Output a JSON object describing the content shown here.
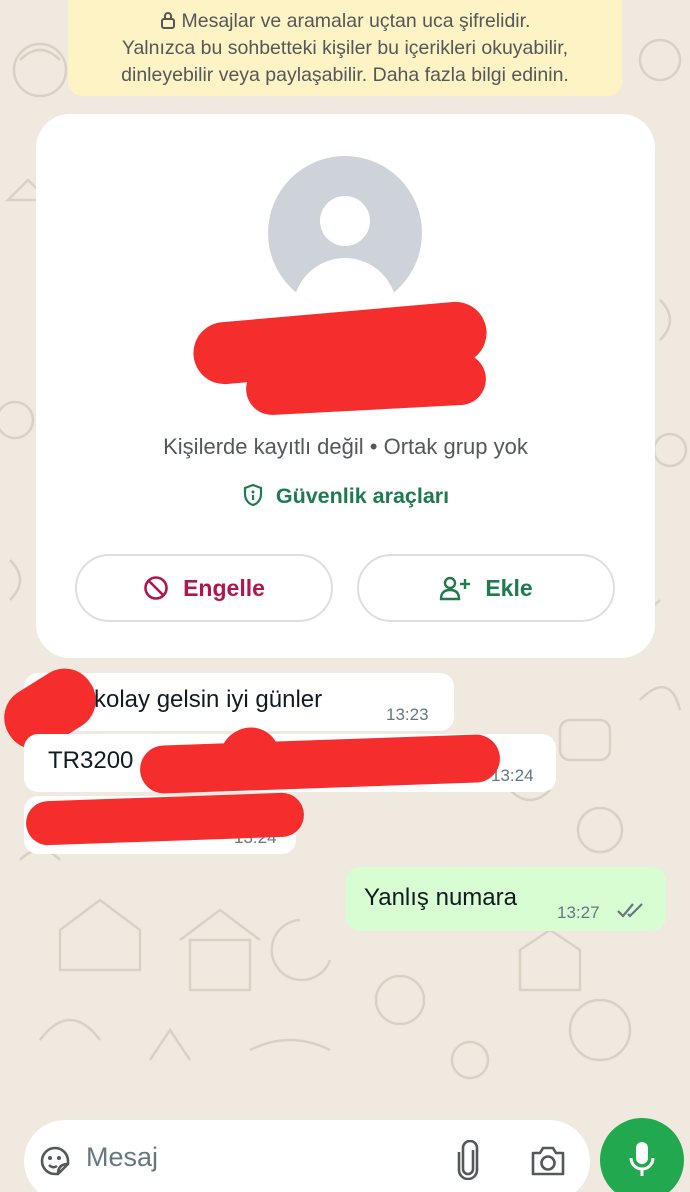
{
  "banner": {
    "line1": "Mesajlar ve aramalar uçtan uca şifrelidir.",
    "line2": "Yalnızca bu sohbetteki kişiler bu içerikleri okuyabilir,",
    "line3": "dinleyebilir veya paylaşabilir. Daha fazla bilgi edinin."
  },
  "contact_card": {
    "subtitle": "Kişilerde kayıtlı değil • Ortak grup yok",
    "security_tools": "Güvenlik araçları",
    "block_button": "Engelle",
    "add_button": "Ekle"
  },
  "messages": [
    {
      "direction": "incoming",
      "text": "kolay gelsin iyi günler",
      "time": "13:23"
    },
    {
      "direction": "incoming",
      "text": "TR3200",
      "time": "13:24"
    },
    {
      "direction": "incoming",
      "text": "",
      "time": "13:24"
    },
    {
      "direction": "outgoing",
      "text": "Yanlış numara",
      "time": "13:27",
      "status": "read"
    }
  ],
  "composer": {
    "placeholder": "Mesaj"
  },
  "colors": {
    "accent_green": "#1f7a4f",
    "block_red": "#b0174e",
    "mic_green": "#22a84f",
    "outgoing_bubble": "#d9fdd3",
    "banner_yellow": "#fdf3c5"
  },
  "icons": [
    "lock-icon",
    "shield-icon",
    "block-icon",
    "add-person-icon",
    "read-receipt-icon",
    "sticker-icon",
    "attach-icon",
    "camera-icon",
    "mic-icon"
  ]
}
